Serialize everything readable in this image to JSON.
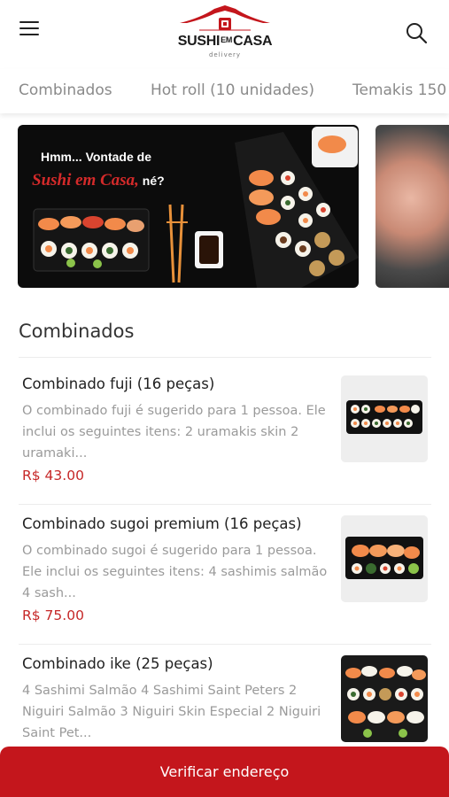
{
  "header": {
    "menu_icon": "hamburger-menu-icon",
    "search_icon": "search-icon",
    "logo": {
      "brand_left": "SUSHI",
      "brand_mid": "EM",
      "brand_right": "CASA",
      "sub": "delivery",
      "accent": "#c4161c"
    }
  },
  "tabs": [
    "Combinados",
    "Hot roll (10 unidades)",
    "Temakis 150"
  ],
  "banner": {
    "line1": "Hmm... Vontade de",
    "line2_highlight": "Sushi em Casa,",
    "line2_rest": " né?"
  },
  "section": {
    "title": "Combinados"
  },
  "items": [
    {
      "name": "Combinado fuji (16 peças)",
      "desc": "O combinado fuji é sugerido para 1 pessoa. Ele inclui os seguintes itens: 2 uramakis skin 2 uramaki...",
      "price": "R$ 43.00"
    },
    {
      "name": "Combinado sugoi premium (16 peças)",
      "desc": "O combinado sugoi é sugerido para 1 pessoa. Ele inclui os seguintes itens: 4 sashimis salmão 4 sash...",
      "price": "R$ 75.00"
    },
    {
      "name": "Combinado ike (25 peças)",
      "desc": "4 Sashimi Salmão 4 Sashimi Saint Peters 2 Niguiri Salmão 3 Niguiri Skin Especial 2 Niguiri Saint Pet...",
      "price": ""
    }
  ],
  "cta": {
    "label": "Verificar endereço",
    "color": "#c4161c"
  },
  "colors": {
    "price": "#c62828",
    "muted_text": "#9a9a9a",
    "tab_text": "#8a8a8a"
  }
}
